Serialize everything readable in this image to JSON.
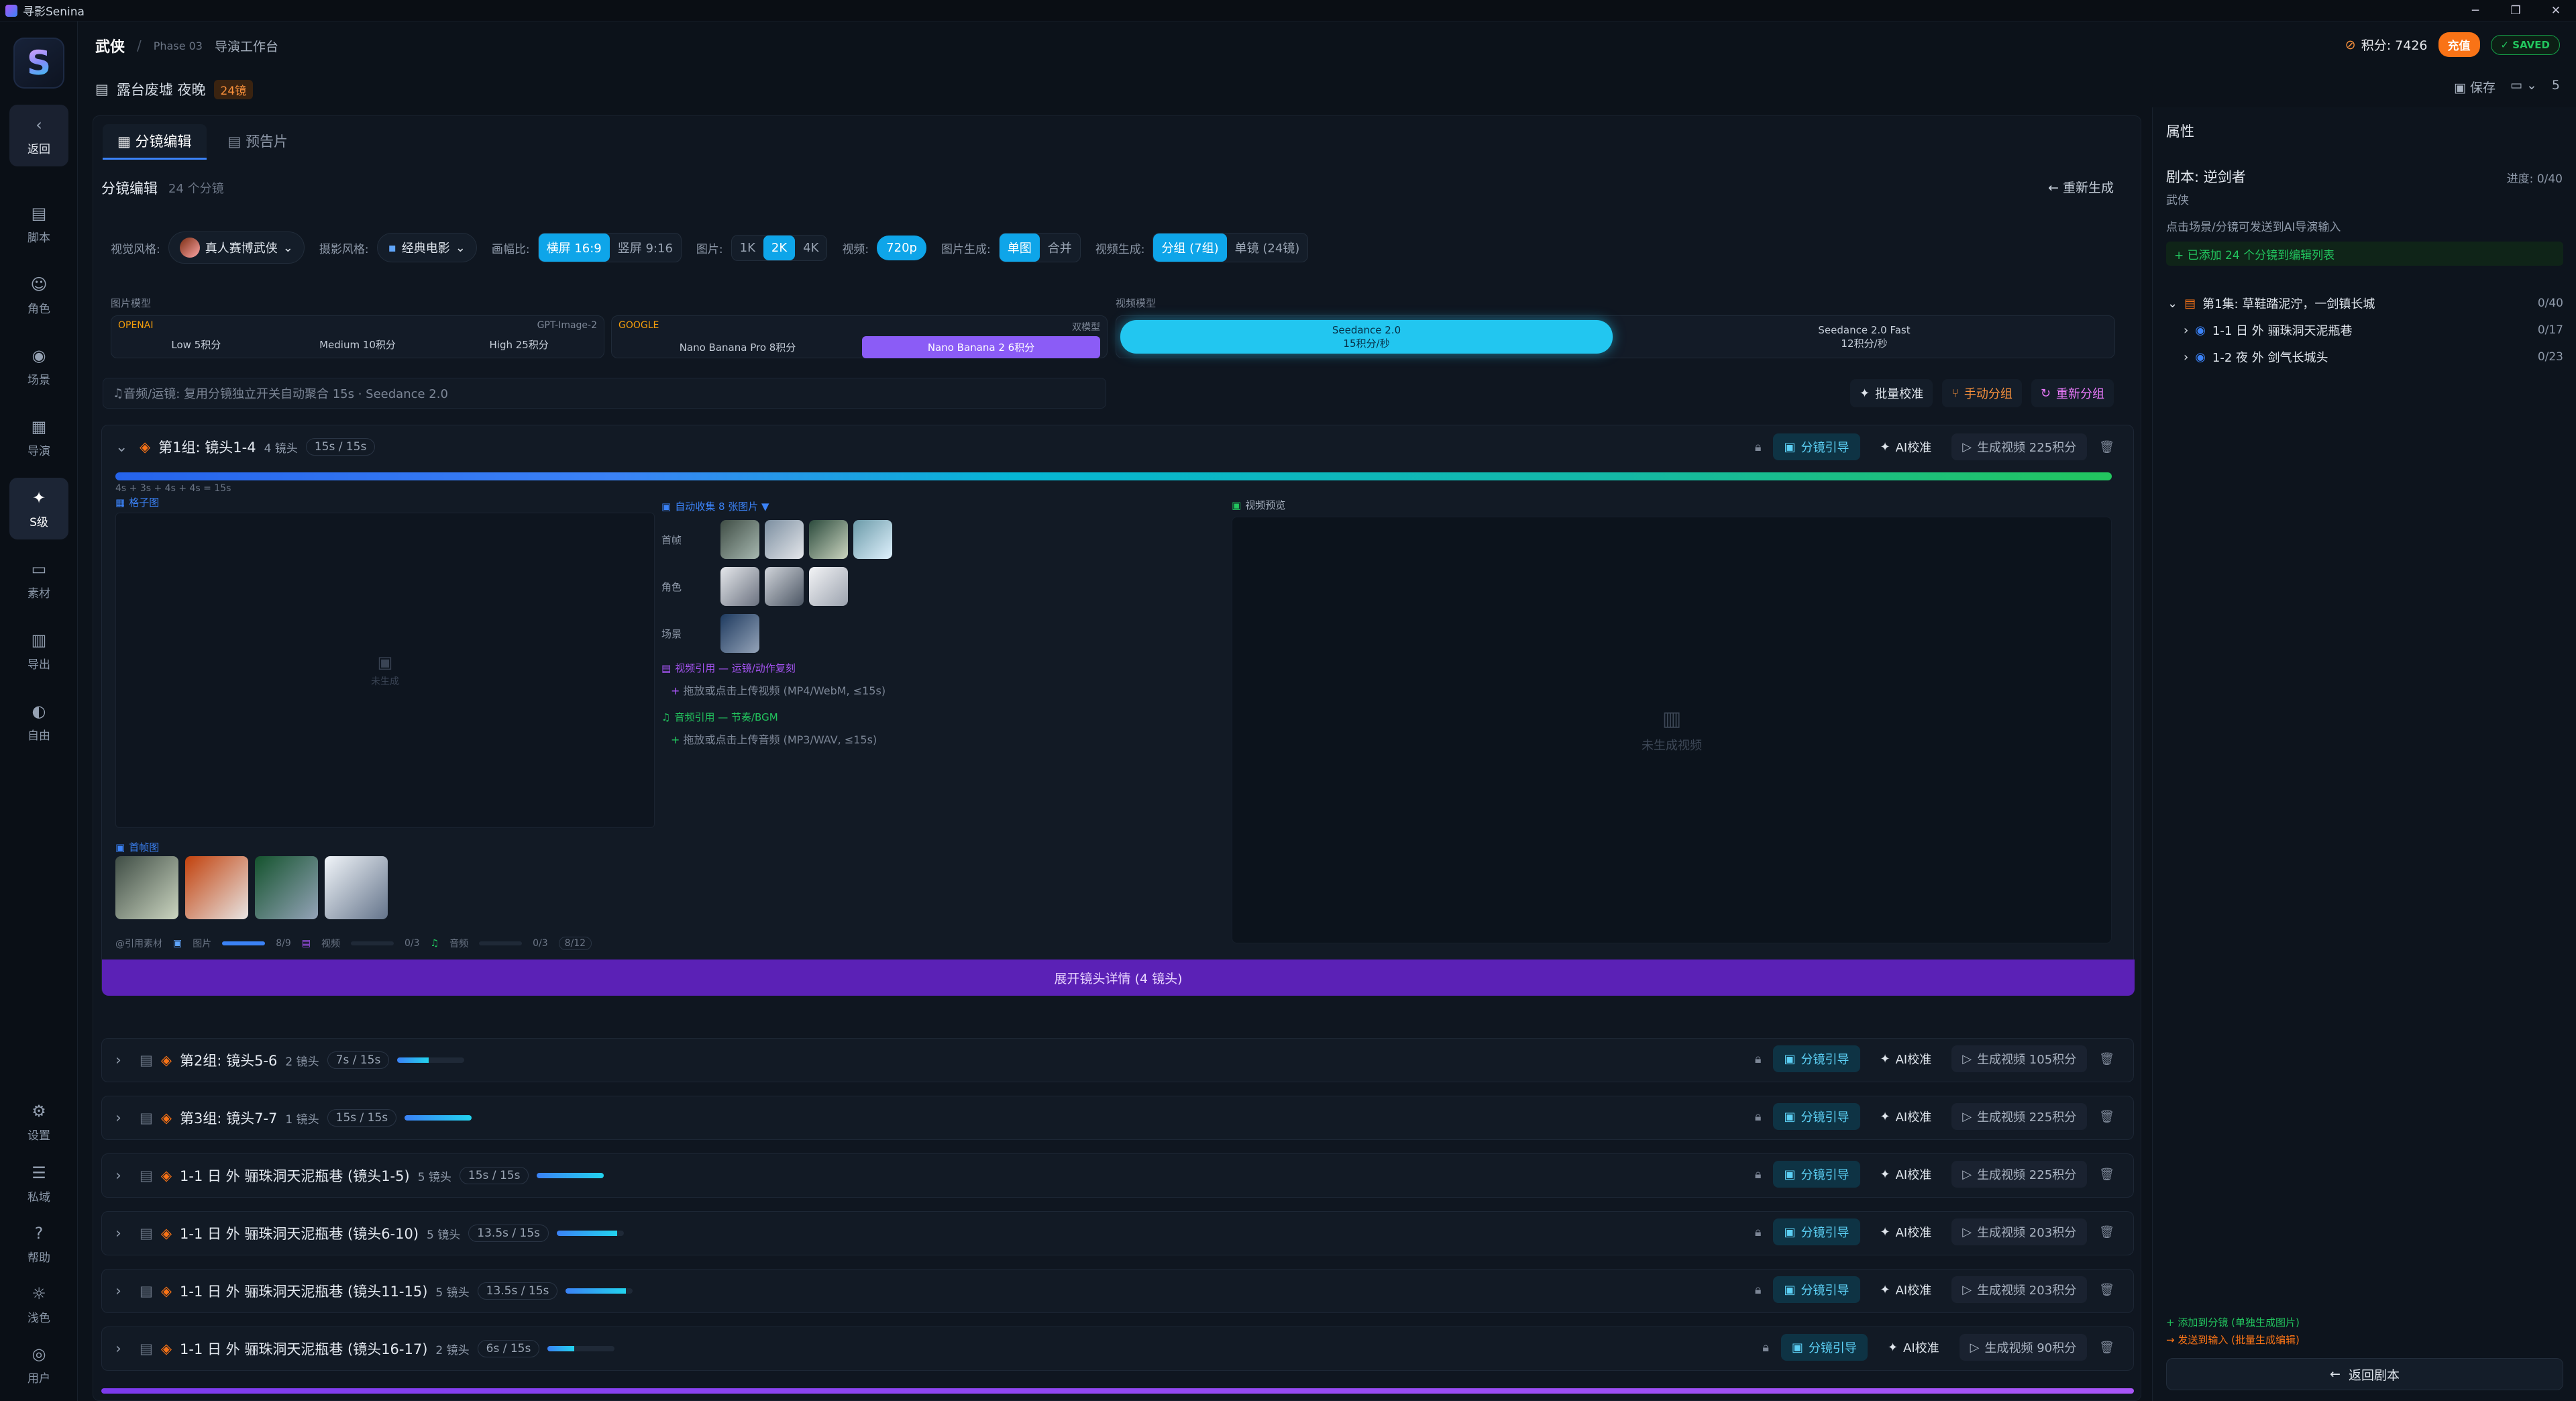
{
  "app": {
    "title": "寻影Senina"
  },
  "window": {
    "minimize": "─",
    "maximize": "❐",
    "close": "✕"
  },
  "sidebar": {
    "back": "返回",
    "items": [
      {
        "label": "脚本",
        "icon": "script-icon"
      },
      {
        "label": "角色",
        "icon": "people-icon"
      },
      {
        "label": "场景",
        "icon": "location-icon"
      },
      {
        "label": "导演",
        "icon": "clapper-icon"
      },
      {
        "label": "S级",
        "icon": "sparkle-icon"
      },
      {
        "label": "素材",
        "icon": "camera-icon"
      },
      {
        "label": "导出",
        "icon": "film-icon"
      },
      {
        "label": "自由",
        "icon": "palette-icon"
      }
    ],
    "bottom": [
      {
        "label": "设置"
      },
      {
        "label": "私域"
      },
      {
        "label": "帮助"
      },
      {
        "label": "浅色"
      },
      {
        "label": "用户"
      }
    ]
  },
  "header": {
    "project": "武侠",
    "phase": "Phase 03",
    "stage": "导演工作台",
    "scene": "露台废墟 夜晚",
    "scene_count": "24镜",
    "points_label": "积分: 7426",
    "charge": "充值",
    "saved": "✓ SAVED",
    "save": "保存",
    "page": "5"
  },
  "tabs": [
    {
      "label": "分镜编辑",
      "active": true
    },
    {
      "label": "预告片",
      "active": false
    }
  ],
  "section": {
    "title": "分镜编辑",
    "count": "24 个分镜",
    "regen": "重新生成"
  },
  "controls": {
    "visual_style_label": "视觉风格:",
    "visual_style": "真人赛博武侠",
    "camera_style_label": "摄影风格:",
    "camera_style": "经典电影",
    "ratio_label": "画幅比:",
    "ratio_options": [
      "横屏 16:9",
      "竖屏 9:16"
    ],
    "image_label": "图片:",
    "image_res": [
      "1K",
      "2K",
      "4K"
    ],
    "video_label": "视频:",
    "video_res": "720p",
    "img_gen_label": "图片生成:",
    "img_gen": [
      "单图",
      "合并"
    ],
    "vid_gen_label": "视频生成:",
    "vid_gen": [
      "分组 (7组)",
      "单镜 (24镜)"
    ]
  },
  "models": {
    "image_label": "图片模型",
    "openai": "OPENAI",
    "openai_model": "GPT-Image-2",
    "openai_opts": [
      "Low 5积分",
      "Medium 10积分",
      "High 25积分"
    ],
    "google": "GOOGLE",
    "google_tag": "双模型",
    "google_opts": [
      "Nano Banana Pro 8积分",
      "Nano Banana 2 6积分"
    ],
    "video_label": "视频模型",
    "video_opts": [
      {
        "name": "Seedance 2.0",
        "price": "15积分/秒"
      },
      {
        "name": "Seedance 2.0 Fast",
        "price": "12积分/秒"
      }
    ]
  },
  "hint": "音频/运镜: 复用分镜独立开关自动聚合 15s · Seedance 2.0",
  "tools": {
    "batch": "批量校准",
    "manual": "手动分组",
    "regroup": "重新分组"
  },
  "group1": {
    "title": "第1组: 镜头1-4",
    "shots": "4 镜头",
    "time": "15s / 15s",
    "timing": "4s + 3s + 4s + 4s = 15s",
    "storyboard": "格子图",
    "placeholder": "未生成",
    "auto": "自动收集 8 张图片 ▼",
    "auto_rows": [
      "首帧",
      "角色",
      "场景"
    ],
    "video_ref": "视频引用 — 运镜/动作复刻",
    "video_upload": "拖放或点击上传视频 (MP4/WebM, ≤15s)",
    "audio_ref": "音频引用 — 节奏/BGM",
    "audio_upload": "拖放或点击上传音频 (MP3/WAV, ≤15s)",
    "keyframes": "首帧图",
    "stats": "@引用素材",
    "stat_img": "图片",
    "stat_img_val": "8/9",
    "stat_vid": "视频",
    "stat_vid_val": "0/3",
    "stat_aud": "音频",
    "stat_aud_val": "0/3",
    "stat_total": "8/12",
    "preview": "视频预览",
    "not_gen": "未生成视频",
    "expand": "展开镜头详情 (4 镜头)",
    "ref": "分镜引导",
    "ai": "AI校准",
    "gen": "生成视频 225积分"
  },
  "groups": [
    {
      "title": "第2组: 镜头5-6",
      "shots": "2 镜头",
      "time": "7s / 15s",
      "fill": 0.47,
      "gen": "生成视频 105积分"
    },
    {
      "title": "第3组: 镜头7-7",
      "shots": "1 镜头",
      "time": "15s / 15s",
      "fill": 1.0,
      "gen": "生成视频 225积分"
    },
    {
      "title": "1-1 日 外 骊珠洞天泥瓶巷 (镜头1-5)",
      "shots": "5 镜头",
      "time": "15s / 15s",
      "fill": 1.0,
      "gen": "生成视频 225积分"
    },
    {
      "title": "1-1 日 外 骊珠洞天泥瓶巷 (镜头6-10)",
      "shots": "5 镜头",
      "time": "13.5s / 15s",
      "fill": 0.9,
      "gen": "生成视频 203积分"
    },
    {
      "title": "1-1 日 外 骊珠洞天泥瓶巷 (镜头11-15)",
      "shots": "5 镜头",
      "time": "13.5s / 15s",
      "fill": 0.9,
      "gen": "生成视频 203积分"
    },
    {
      "title": "1-1 日 外 骊珠洞天泥瓶巷 (镜头16-17)",
      "shots": "2 镜头",
      "time": "6s / 15s",
      "fill": 0.4,
      "gen": "生成视频 90积分"
    }
  ],
  "group_btn": {
    "ref": "分镜引导",
    "ai": "AI校准"
  },
  "right": {
    "title": "属性",
    "script": "剧本: 逆剑者",
    "progress": "进度: 0/40",
    "genre": "武侠",
    "hint": "点击场景/分镜可发送到AI导演输入",
    "added": "+ 已添加 24 个分镜到编辑列表",
    "ep": "第1集: 草鞋踏泥泞，一剑镇长城",
    "ep_cnt": "0/40",
    "scenes": [
      {
        "title": "1-1 日 外 骊珠洞天泥瓶巷",
        "cnt": "0/17"
      },
      {
        "title": "1-2 夜 外 剑气长城头",
        "cnt": "0/23"
      }
    ],
    "foot1": "+ 添加到分镜 (单独生成图片)",
    "foot2": "→ 发送到输入 (批量生成编辑)",
    "back": "返回剧本"
  }
}
